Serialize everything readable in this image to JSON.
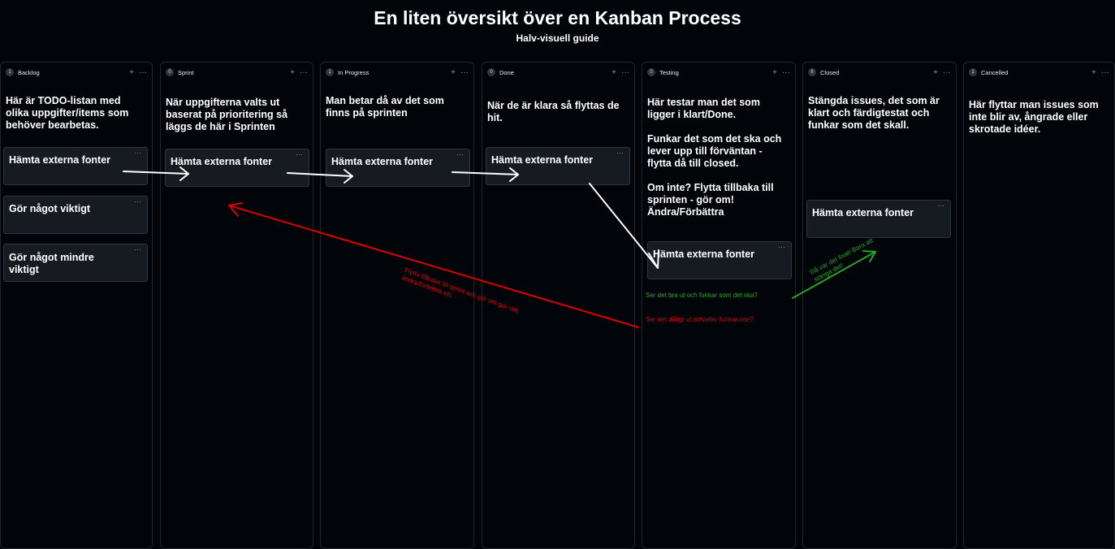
{
  "header": {
    "title": "En liten översikt över en Kanban Process",
    "subtitle": "Halv-visuell guide"
  },
  "columns": [
    {
      "name": "Backlog",
      "count": "1",
      "description": "Här är TODO-listan med olika uppgifter/items som behöver bearbetas.",
      "cards": [
        "Hämta externa fonter",
        "Gör något viktigt",
        "Gör något mindre viktigt"
      ]
    },
    {
      "name": "Sprint",
      "count": "0",
      "description": "När uppgifterna valts ut baserat på prioritering så läggs de här i Sprinten",
      "cards": [
        "Hämta externa fonter"
      ]
    },
    {
      "name": "In Progress",
      "count": "1",
      "description": "Man betar då av det som finns på sprinten",
      "cards": [
        "Hämta externa fonter"
      ]
    },
    {
      "name": "Done",
      "count": "0",
      "description": "När de är klara så flyttas de hit.",
      "cards": [
        "Hämta externa fonter"
      ]
    },
    {
      "name": "Testing",
      "count": "0",
      "description": "Här testar man det som ligger i klart/Done.\n\nFunkar det som det ska och lever upp till förväntan - flytta då till closed.\n\nOm inte? Flytta tillbaka till sprinten - gör om! Ändra/Förbättra",
      "cards": [
        "Hämta externa fonter"
      ]
    },
    {
      "name": "Closed",
      "count": "6",
      "description": "Stängda issues, det som är klart och färdigtestat och funkar som det skall.",
      "cards": [
        "Hämta externa fonter"
      ]
    },
    {
      "name": "Cancelled",
      "count": "1",
      "description": "Här flyttar man issues som inte blir av, ångrade eller skrotade idéer.",
      "cards": []
    }
  ],
  "column_actions": {
    "add": "+",
    "more": "···"
  },
  "card_menu": "···",
  "annotations": {
    "good_question": "Ser det bra ut och funkar som det ska?",
    "bad_question": "Ser det dåligt ut och/eller funkar inte?",
    "good_comment": "Då var det fixat! Bara att stänga det!",
    "bad_comment": "Flytta tillbaka till sprint och gör om gör rätt, ändra/förbättra etc."
  },
  "colors": {
    "background": "#010409",
    "card": "#161b22",
    "arrow_white": "#ffffff",
    "arrow_red": "#e00000",
    "arrow_green": "#22aa22"
  }
}
